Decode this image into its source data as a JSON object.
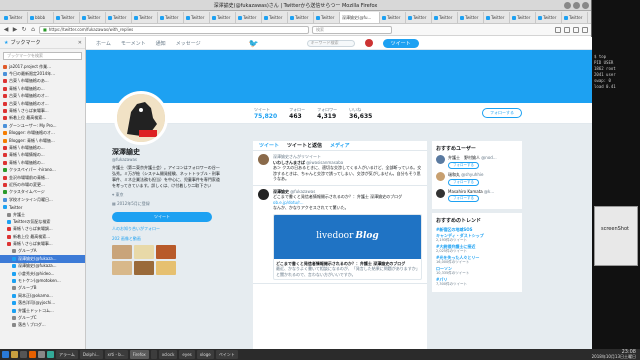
{
  "window_title": "深澤諭史(@fukazawas)さん | Twitterから送信せらつー Mozilla Firefox",
  "tabs": [
    "Twitter",
    "bbbb",
    "Twitter",
    "Twitter",
    "Twitter",
    "Twitter",
    "Twitter",
    "Twitter",
    "Twitter",
    "Twitter",
    "Twitter",
    "Twitter",
    "Twitter",
    "Twitter",
    "Twitter",
    "Twitter",
    "Twitter",
    "Twitter",
    "Twitter",
    "Twitter",
    "Twitter"
  ],
  "active_tab": "深澤諭史(@fu...",
  "url": "https://twitter.com/fukazawas/with_replies",
  "browser_search_placeholder": "検索",
  "sidebar": {
    "title": "ブックマーク",
    "search_placeholder": "ブックマークを検索",
    "items": [
      {
        "label": "ja2017.project 作業...",
        "color": "#e05a2a"
      },
      {
        "label": "今日の最新限定2014年...",
        "color": "#4a90d9"
      },
      {
        "label": "古東 \\ 市場価格のあ...",
        "color": "#d33"
      },
      {
        "label": "青帳 \\ 市場価格の...",
        "color": "#d33"
      },
      {
        "label": "古東 \\ 市場価格のオ...",
        "color": "#d33"
      },
      {
        "label": "古東 \\ 市場価格のオ...",
        "color": "#d33"
      },
      {
        "label": "青帳 \\ さらば来場事...",
        "color": "#d33"
      },
      {
        "label": "新着上位 最高検索...",
        "color": "#d33"
      },
      {
        "label": "グーンユーザー: My Pro...",
        "color": "#4a90d9"
      },
      {
        "label": "Blogger: 市場価格のオ...",
        "color": "#f57d00"
      },
      {
        "label": "Blogger: 青帳 \\ 市場価...",
        "color": "#f57d00"
      },
      {
        "label": "青帳 \\ 市場価格の...",
        "color": "#d33"
      },
      {
        "label": "青帳 \\ 市場情報の...",
        "color": "#d33"
      },
      {
        "label": "青帳 \\ 市場価格の...",
        "color": "#d33"
      },
      {
        "label": "クラスペイパー -hirano...",
        "color": "#2a9a2a"
      },
      {
        "label": "金沢市場場前の青帳...",
        "color": "#d33"
      },
      {
        "label": "近所の市場の変更...",
        "color": "#d33"
      },
      {
        "label": "クラスタイムページ",
        "color": "#2a9a2a"
      },
      {
        "label": "学校オンライン月曜日...",
        "color": "#4a90d9"
      },
      {
        "label": "Twitter",
        "color": "#1da1f2"
      },
      {
        "label": "弁護士",
        "color": "#888"
      },
      {
        "label": "Twitterの気配な検索",
        "color": "#1da1f2"
      },
      {
        "label": "青帳 \\ さらば来場調...",
        "color": "#d33"
      },
      {
        "label": "新着上位 最高検索...",
        "color": "#d33"
      },
      {
        "label": "青帳 \\ さらば来場事...",
        "color": "#d33"
      },
      {
        "label": "グループA",
        "color": "#888"
      },
      {
        "label": "深澤諭史(@fukaza...",
        "color": "#1da1f2"
      },
      {
        "label": "深澤諭史(@fukaza...",
        "color": "#1da1f2"
      },
      {
        "label": "小倉秀夫(@hideo...",
        "color": "#1da1f2"
      },
      {
        "label": "モトケン(@motoken...",
        "color": "#1da1f2"
      },
      {
        "label": "グループB",
        "color": "#888"
      },
      {
        "label": "岡本正(@okamo...",
        "color": "#1da1f2"
      },
      {
        "label": "落合洋司(@yjochi...",
        "color": "#1da1f2"
      },
      {
        "label": "弁護士ドットコム...",
        "color": "#1da1f2"
      },
      {
        "label": "グループC",
        "color": "#888"
      },
      {
        "label": "落合 \\ ブログ...",
        "color": "#888"
      }
    ],
    "selected_index": 26
  },
  "twitter_nav": {
    "home": "ホーム",
    "moments": "モーメント",
    "notifications": "通知",
    "messages": "メッセージ",
    "search_placeholder": "キーワード検索",
    "tweet_button": "ツイート"
  },
  "stats": [
    {
      "label": "ツイート",
      "value": "75,820"
    },
    {
      "label": "フォロー",
      "value": "463"
    },
    {
      "label": "フォロワー",
      "value": "4,319"
    },
    {
      "label": "いいね",
      "value": "36,635"
    }
  ],
  "follow_button": "フォローする",
  "profile": {
    "name": "深澤諭史",
    "handle": "@fukazawas",
    "bio": "弁護士（第二東京弁護士会）。アイコンはフォロワーの谷一弘秀。ミ万が絵（システム開発経験、ネットトラブル・刑事事件、ミネ企業法務も担当）を中心に、児童事件を専門家道を考ってきています。詳しくは、け付着しり二取下さい",
    "location": "東京",
    "joined": "2012年5月に登録",
    "tweet_to": "ツイート",
    "followers_you_know": "人のお知り合いがフォロー",
    "media": "202 画像と動画"
  },
  "timeline": {
    "tabs": [
      "ツイート",
      "ツイートと返信",
      "メディア"
    ],
    "tweets": [
      {
        "retweeted": "深澤諭史さんがリツイート",
        "name": "いわしさんまさば",
        "handle": "@iwasisanmasaba",
        "body": "あ＞ クスの日あるときに、適切な交渉してくる人がいるけど、全部断っている。交渉するときは、ちゃんと交渉で誘ってしまい、交渉が気がしません。自分もそう思うなあ。"
      },
      {
        "retweeted": "",
        "name": "深澤諭史",
        "handle": "@fukazawas",
        "body": "どこまで書くと発信者情報開示されるのか？：弁護士 深澤諭史のブログ",
        "link": "ob.e.jp/dotu/r...",
        "body2": "なんか、かなりアクセスされてて驚いた。",
        "card_title": "どこまで書くと発信者情報開示されるのか？：弁護士 深澤諭史のブログ",
        "card_desc": "最近、かなりよく書いて相談になるのが、「発言した結果に問題がありますか」と聞かれるので、言わない方がいいですか。",
        "card_logo": "livedoor",
        "card_logo2": "Blog"
      }
    ]
  },
  "who_to_follow": {
    "title": "おすすめユーザー",
    "users": [
      {
        "name": "弁護士　野村諭人",
        "handle": "@nod..."
      },
      {
        "name": "瑞和丸",
        "handle": "@shyuhhie"
      },
      {
        "name": "Masahiro Kamata",
        "handle": "@k..."
      }
    ],
    "button": "フォローする"
  },
  "trends": {
    "title": "おすすめのトレンド",
    "items": [
      {
        "tag": "#新宿区の地域SOS",
        "count": ""
      },
      {
        "tag": "キャンディ・ダストシップ",
        "count": "2,193件のツイート"
      },
      {
        "tag": "#大統領弁護士に接近",
        "count": "2,025件のツイート"
      },
      {
        "tag": "#光を失った人々とリー",
        "count": "16,000件のツイート"
      },
      {
        "tag": "ローソン",
        "count": "10,335件のツイート"
      },
      {
        "tag": "#パリ",
        "count": "7,300件のツイート"
      }
    ]
  },
  "terminal_lines": [
    "$ top",
    "PID USER",
    "1862 root",
    "2041 user",
    "swap: 0",
    "load 0.41"
  ],
  "right_window_title": "screenShot",
  "taskbar": {
    "items": [
      "アラーム",
      "Dolphi...",
      "xrti - b...",
      "Firefox",
      "",
      "xclock",
      "eyes",
      "xloge",
      "ペイント"
    ],
    "active": 3,
    "time": "23:08",
    "date": "2018年10月13日土曜日"
  }
}
